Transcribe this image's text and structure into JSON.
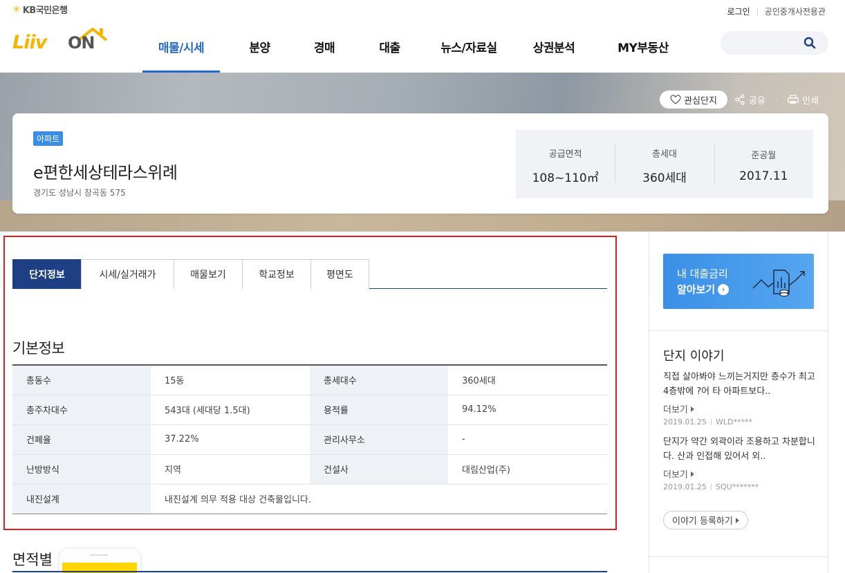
{
  "header": {
    "kb_brand": "KB국민은행",
    "liiv": "Liiv",
    "on": "ON",
    "login": "로그인",
    "agent_link": "공인중개사전용관",
    "nav": [
      {
        "label": "매물/시세",
        "active": true
      },
      {
        "label": "분양",
        "active": false
      },
      {
        "label": "경매",
        "active": false
      },
      {
        "label": "대출",
        "active": false
      },
      {
        "label": "뉴스/자료실",
        "active": false
      },
      {
        "label": "상권분석",
        "active": false
      },
      {
        "label": "MY부동산",
        "active": false
      }
    ],
    "search_placeholder": ""
  },
  "hero": {
    "favorite_label": "관심단지",
    "share_label": "공유",
    "print_label": "인쇄"
  },
  "complex": {
    "type_badge": "아파트",
    "name": "e편한세상테라스위례",
    "address": "경기도 성남시 창곡동 575",
    "stats": [
      {
        "label": "공급면적",
        "value": "108~110㎡"
      },
      {
        "label": "총세대",
        "value": "360세대"
      },
      {
        "label": "준공월",
        "value": "2017.11"
      }
    ]
  },
  "tabs": [
    {
      "label": "단지정보",
      "active": true
    },
    {
      "label": "시세/실거래가",
      "active": false
    },
    {
      "label": "매물보기",
      "active": false
    },
    {
      "label": "학교정보",
      "active": false
    },
    {
      "label": "평면도",
      "active": false
    }
  ],
  "basic_info": {
    "title": "기본정보",
    "rows": [
      [
        {
          "k": "총동수",
          "v": "15동"
        },
        {
          "k": "총세대수",
          "v": "360세대"
        }
      ],
      [
        {
          "k": "총주차대수",
          "v": "543대 (세대당 1.5대)"
        },
        {
          "k": "용적률",
          "v": "94.12%"
        }
      ],
      [
        {
          "k": "건폐율",
          "v": "37.22%"
        },
        {
          "k": "관리사무소",
          "v": "-"
        }
      ],
      [
        {
          "k": "난방방식",
          "v": "지역"
        },
        {
          "k": "건설사",
          "v": "대림산업(주)"
        }
      ]
    ],
    "quake_label": "내진설계",
    "quake_value": "내진설계 의무 적용 대상 건축물입니다."
  },
  "area_section": {
    "title": "면적별"
  },
  "sidebar": {
    "loan_line1": "내 대출금리",
    "loan_line2": "알아보기",
    "story_title": "단지 이야기",
    "stories": [
      {
        "text": "직접 살아봐야 느끼는거지만 층수가 최고 4층밖에 ?어 타 아파트보다..",
        "more": "더보기",
        "date": "2019.01.25",
        "author": "WLD*****"
      },
      {
        "text": "단지가 약간 외곽이라 조용하고 차분합니다. 산과 인접해 있어서 외..",
        "more": "더보기",
        "date": "2019.01.25",
        "author": "SQU*******"
      }
    ],
    "story_button": "이야기 등록하기"
  },
  "colors": {
    "brand_blue": "#2469c9",
    "tab_navy": "#1e3f83",
    "kb_yellow": "#f5b400",
    "highlight_red": "#e21b1b"
  }
}
